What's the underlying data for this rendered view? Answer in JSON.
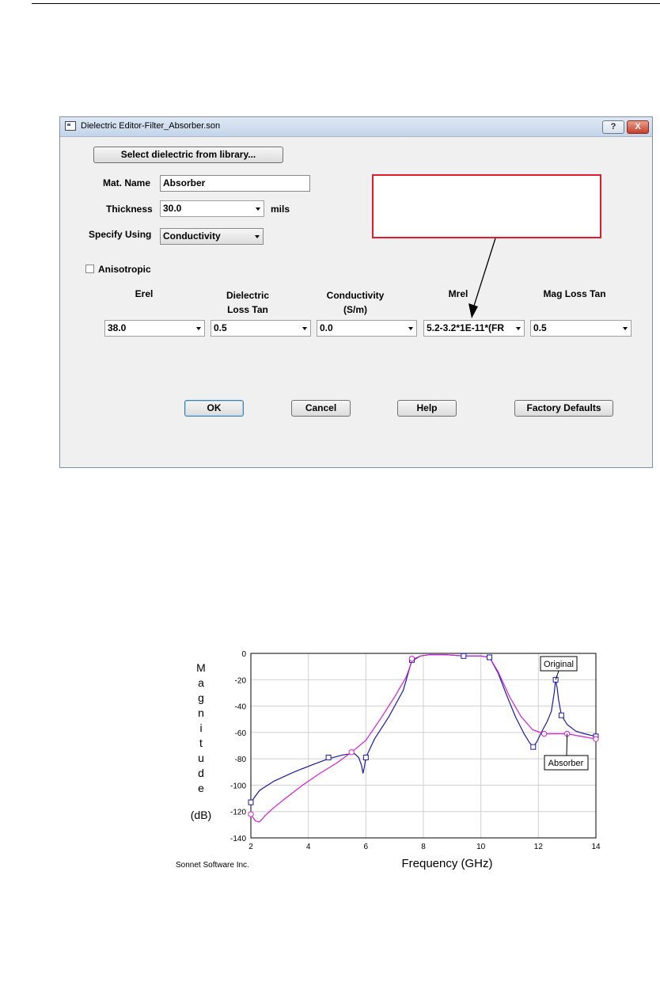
{
  "dialog": {
    "title": "Dielectric Editor-Filter_Absorber.son",
    "help_button": "?",
    "close_button": "X",
    "select_library_button": "Select dielectric from library...",
    "mat_name_label": "Mat. Name",
    "mat_name_value": "Absorber",
    "thickness_label": "Thickness",
    "thickness_value": "30.0",
    "thickness_unit": "mils",
    "specify_using_label": "Specify Using",
    "specify_using_value": "Conductivity",
    "anisotropic_label": "Anisotropic",
    "columns": [
      {
        "header_line1": "Erel",
        "header_line2": "",
        "value": "38.0"
      },
      {
        "header_line1": "Dielectric",
        "header_line2": "Loss Tan",
        "value": "0.5"
      },
      {
        "header_line1": "Conductivity",
        "header_line2": "(S/m)",
        "value": "0.0"
      },
      {
        "header_line1": "Mrel",
        "header_line2": "",
        "value": "5.2-3.2*1E-11*(FR"
      },
      {
        "header_line1": "Mag Loss Tan",
        "header_line2": "",
        "value": "0.5"
      }
    ],
    "ok_button": "OK",
    "cancel_button": "Cancel",
    "help_text_button": "Help",
    "factory_defaults_button": "Factory Defaults"
  },
  "colors": {
    "callout_border": "#e01b2c",
    "original_series": "#1a1aa8",
    "absorber_series": "#d21fd2"
  },
  "chart_data": {
    "type": "line",
    "title": "",
    "xlabel": "Frequency (GHz)",
    "ylabel": "Magnitude (dB)",
    "ylabel_letters": [
      "M",
      "a",
      "g",
      "n",
      "i",
      "t",
      "u",
      "d",
      "e"
    ],
    "ylabel_unit": "(dB)",
    "credit": "Sonnet Software Inc.",
    "xlim": [
      2,
      14
    ],
    "ylim": [
      -140,
      0
    ],
    "xticks": [
      2,
      4,
      6,
      8,
      10,
      12,
      14
    ],
    "yticks": [
      0,
      -20,
      -40,
      -60,
      -80,
      -100,
      -120,
      -140
    ],
    "grid": true,
    "series": [
      {
        "name": "Original",
        "marker": "square",
        "x": [
          2.0,
          2.3,
          2.8,
          3.5,
          4.2,
          4.7,
          5.2,
          5.6,
          5.75,
          5.85,
          5.9,
          5.95,
          6.0,
          6.3,
          6.8,
          7.3,
          7.6,
          7.9,
          8.2,
          8.8,
          9.4,
          10.0,
          10.3,
          10.6,
          10.9,
          11.2,
          11.5,
          11.7,
          11.82,
          11.95,
          12.1,
          12.3,
          12.45,
          12.55,
          12.6,
          12.65,
          12.7,
          12.8,
          13.0,
          13.3,
          13.6,
          14.0
        ],
        "y": [
          -113,
          -104,
          -97,
          -90,
          -84,
          -80,
          -77,
          -76,
          -79,
          -85,
          -91,
          -86,
          -79,
          -65,
          -48,
          -28,
          -5,
          -2,
          -1,
          -1,
          -2,
          -2,
          -3,
          -15,
          -32,
          -48,
          -61,
          -68,
          -71,
          -67,
          -60,
          -52,
          -44,
          -30,
          -20,
          -26,
          -35,
          -47,
          -54,
          -59,
          -61,
          -63
        ]
      },
      {
        "name": "Absorber",
        "marker": "circle",
        "x": [
          2.0,
          2.15,
          2.3,
          2.5,
          2.8,
          3.2,
          3.8,
          4.4,
          5.0,
          5.5,
          6.0,
          6.5,
          7.0,
          7.4,
          7.6,
          7.9,
          8.2,
          8.8,
          9.4,
          10.0,
          10.3,
          10.6,
          11.0,
          11.4,
          11.8,
          12.2,
          12.6,
          13.0,
          13.5,
          14.0
        ],
        "y": [
          -122,
          -127,
          -128,
          -123,
          -117,
          -110,
          -100,
          -91,
          -83,
          -75,
          -66,
          -50,
          -33,
          -18,
          -6,
          -2,
          -1,
          -1,
          -2,
          -2,
          -3,
          -14,
          -33,
          -48,
          -58,
          -61,
          -61,
          -61,
          -63,
          -65
        ]
      }
    ],
    "markers": [
      {
        "series": "Original",
        "x": [
          2,
          4.7,
          6,
          7.6,
          9.4,
          10.3,
          11.82,
          12.6,
          12.8,
          14
        ],
        "y": [
          -113,
          -79,
          -79,
          -5,
          -2,
          -3,
          -71,
          -20,
          -47,
          -63
        ]
      },
      {
        "series": "Absorber",
        "x": [
          2,
          5.5,
          7.6,
          12.2,
          13,
          14
        ],
        "y": [
          -122,
          -75,
          -4,
          -61,
          -61,
          -65
        ]
      }
    ],
    "annotations": [
      {
        "text": "Original",
        "x": 12.6,
        "y": -20
      },
      {
        "text": "Absorber",
        "x": 13.0,
        "y": -61
      }
    ]
  }
}
